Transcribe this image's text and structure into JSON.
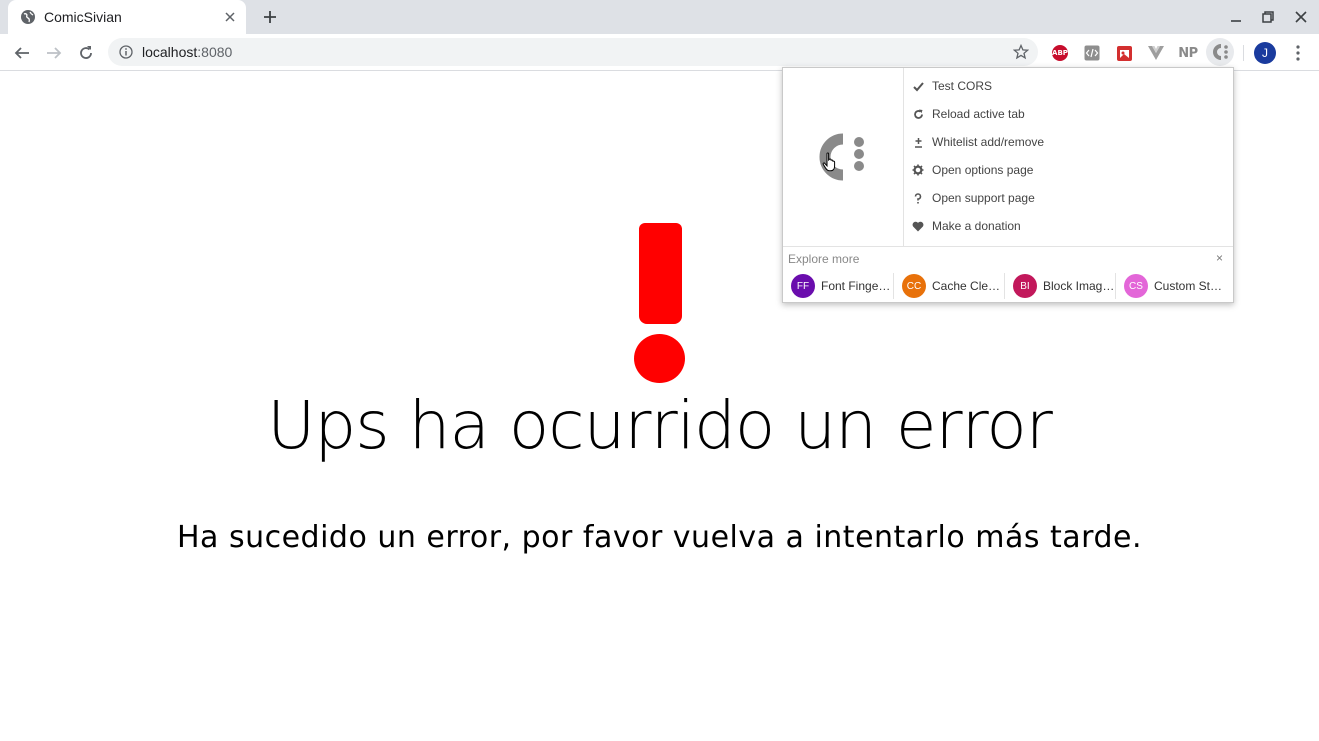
{
  "tab": {
    "title": "ComicSivian"
  },
  "address_bar": {
    "host": "localhost",
    "port": ":8080"
  },
  "extensions": {
    "abp_label": "ABP",
    "np_label": "NP"
  },
  "profile": {
    "initial": "J"
  },
  "page": {
    "heading": "Ups ha ocurrido un error",
    "message": "Ha sucedido un error, por favor vuelva a intentarlo más tarde.",
    "accent_color": "#ff0000"
  },
  "popup": {
    "menu": [
      {
        "label": "Test CORS",
        "icon": "check-icon"
      },
      {
        "label": "Reload active tab",
        "icon": "reload-icon"
      },
      {
        "label": "Whitelist add/remove",
        "icon": "plus-minus-icon"
      },
      {
        "label": "Open options page",
        "icon": "gear-icon"
      },
      {
        "label": "Open support page",
        "icon": "question-icon"
      },
      {
        "label": "Make a donation",
        "icon": "heart-icon"
      }
    ],
    "explore_label": "Explore more",
    "explore_close": "×",
    "explore_items": [
      {
        "badge": "FF",
        "name": "Font Finger…",
        "color": "#6a0dad"
      },
      {
        "badge": "CC",
        "name": "Cache Clea…",
        "color": "#e8710a"
      },
      {
        "badge": "BI",
        "name": "Block Imag…",
        "color": "#c2185b"
      },
      {
        "badge": "CS",
        "name": "Custom Sty…",
        "color": "#e366d8"
      }
    ]
  }
}
